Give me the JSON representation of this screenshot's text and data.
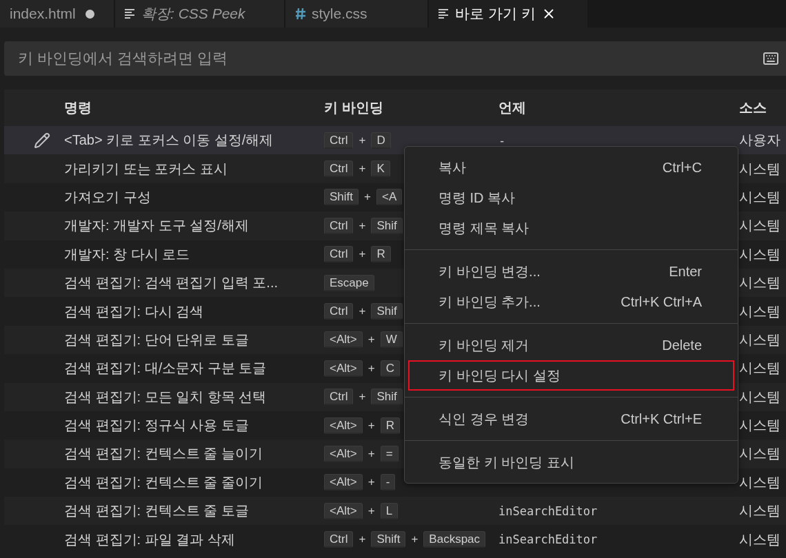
{
  "tabs": [
    {
      "label": "index.html",
      "kind": "html",
      "modified": true,
      "italic": false,
      "selected": false,
      "closable": false
    },
    {
      "label": "확장: CSS Peek",
      "kind": "text",
      "modified": false,
      "italic": true,
      "selected": false,
      "closable": false
    },
    {
      "label": "style.css",
      "kind": "css",
      "modified": false,
      "italic": false,
      "selected": false,
      "closable": false
    },
    {
      "label": "바로 가기 키",
      "kind": "text",
      "modified": false,
      "italic": false,
      "selected": true,
      "closable": true
    }
  ],
  "search": {
    "placeholder": "키 바인딩에서 검색하려면 입력"
  },
  "table": {
    "columns": [
      "명령",
      "키 바인딩",
      "언제",
      "소스"
    ],
    "rows": [
      {
        "command": "<Tab> 키로 포커스 이동 설정/해제",
        "keys": [
          {
            "kind": "key",
            "text": "Ctrl"
          },
          {
            "kind": "plus",
            "text": "+"
          },
          {
            "kind": "key",
            "text": "D"
          }
        ],
        "when": "-",
        "source": "사용자",
        "selected": true
      },
      {
        "command": "가리키기 또는 포커스 표시",
        "keys": [
          {
            "kind": "key",
            "text": "Ctrl"
          },
          {
            "kind": "plus",
            "text": "+"
          },
          {
            "kind": "key",
            "text": "K"
          }
        ],
        "source": "시스템",
        "selected": false
      },
      {
        "command": "가져오기 구성",
        "keys": [
          {
            "kind": "key",
            "text": "Shift"
          },
          {
            "kind": "plus",
            "text": "+"
          },
          {
            "kind": "key",
            "text": "<A"
          }
        ],
        "source": "시스템",
        "selected": false
      },
      {
        "command": "개발자: 개발자 도구 설정/해제",
        "keys": [
          {
            "kind": "key",
            "text": "Ctrl"
          },
          {
            "kind": "plus",
            "text": "+"
          },
          {
            "kind": "key",
            "text": "Shif"
          }
        ],
        "source": "시스템",
        "selected": false
      },
      {
        "command": "개발자: 창 다시 로드",
        "keys": [
          {
            "kind": "key",
            "text": "Ctrl"
          },
          {
            "kind": "plus",
            "text": "+"
          },
          {
            "kind": "key",
            "text": "R"
          }
        ],
        "source": "시스템",
        "selected": false
      },
      {
        "command": "검색 편집기: 검색 편집기 입력 포...",
        "keys": [
          {
            "kind": "key",
            "text": "Escape"
          }
        ],
        "source": "시스템",
        "selected": false
      },
      {
        "command": "검색 편집기: 다시 검색",
        "keys": [
          {
            "kind": "key",
            "text": "Ctrl"
          },
          {
            "kind": "plus",
            "text": "+"
          },
          {
            "kind": "key",
            "text": "Shif"
          }
        ],
        "source": "시스템",
        "selected": false
      },
      {
        "command": "검색 편집기: 단어 단위로 토글",
        "keys": [
          {
            "kind": "key",
            "text": "<Alt>"
          },
          {
            "kind": "plus",
            "text": "+"
          },
          {
            "kind": "key",
            "text": "W"
          }
        ],
        "source": "시스템",
        "selected": false
      },
      {
        "command": "검색 편집기: 대/소문자 구분 토글",
        "keys": [
          {
            "kind": "key",
            "text": "<Alt>"
          },
          {
            "kind": "plus",
            "text": "+"
          },
          {
            "kind": "key",
            "text": "C"
          }
        ],
        "source": "시스템",
        "selected": false
      },
      {
        "command": "검색 편집기: 모든 일치 항목 선택",
        "keys": [
          {
            "kind": "key",
            "text": "Ctrl"
          },
          {
            "kind": "plus",
            "text": "+"
          },
          {
            "kind": "key",
            "text": "Shif"
          }
        ],
        "source": "시스템",
        "selected": false
      },
      {
        "command": "검색 편집기: 정규식 사용 토글",
        "keys": [
          {
            "kind": "key",
            "text": "<Alt>"
          },
          {
            "kind": "plus",
            "text": "+"
          },
          {
            "kind": "key",
            "text": "R"
          }
        ],
        "source": "시스템",
        "selected": false
      },
      {
        "command": "검색 편집기: 컨텍스트 줄 늘이기",
        "keys": [
          {
            "kind": "key",
            "text": "<Alt>"
          },
          {
            "kind": "plus",
            "text": "+"
          },
          {
            "kind": "key",
            "text": "="
          }
        ],
        "source": "시스템",
        "selected": false
      },
      {
        "command": "검색 편집기: 컨텍스트 줄 줄이기",
        "keys": [
          {
            "kind": "key",
            "text": "<Alt>"
          },
          {
            "kind": "plus",
            "text": "+"
          },
          {
            "kind": "key",
            "text": "-"
          }
        ],
        "source": "시스템",
        "selected": false
      },
      {
        "command": "검색 편집기: 컨텍스트 줄 토글",
        "keys": [
          {
            "kind": "key",
            "text": "<Alt>"
          },
          {
            "kind": "plus",
            "text": "+"
          },
          {
            "kind": "key",
            "text": "L"
          }
        ],
        "when": "inSearchEditor",
        "source": "시스템",
        "selected": false
      },
      {
        "command": "검색 편집기: 파일 결과 삭제",
        "keys": [
          {
            "kind": "key",
            "text": "Ctrl"
          },
          {
            "kind": "plus",
            "text": "+"
          },
          {
            "kind": "key",
            "text": "Shift"
          },
          {
            "kind": "plus",
            "text": "+"
          },
          {
            "kind": "key",
            "text": "Backspac"
          }
        ],
        "when": "inSearchEditor",
        "source": "시스템",
        "selected": false
      }
    ]
  },
  "context_menu": {
    "groups": [
      [
        {
          "label": "복사",
          "shortcut": "Ctrl+C",
          "highlighted": false
        },
        {
          "label": "명령 ID 복사",
          "highlighted": false
        },
        {
          "label": "명령 제목 복사",
          "highlighted": false
        }
      ],
      [
        {
          "label": "키 바인딩 변경...",
          "shortcut": "Enter",
          "highlighted": false
        },
        {
          "label": "키 바인딩 추가...",
          "shortcut": "Ctrl+K Ctrl+A",
          "highlighted": false
        }
      ],
      [
        {
          "label": "키 바인딩 제거",
          "shortcut": "Delete",
          "highlighted": false
        },
        {
          "label": "키 바인딩 다시 설정",
          "highlighted": true
        }
      ],
      [
        {
          "label": "식인 경우 변경",
          "shortcut": "Ctrl+K Ctrl+E",
          "highlighted": false
        }
      ],
      [
        {
          "label": "동일한 키 바인딩 표시",
          "highlighted": false
        }
      ]
    ]
  }
}
